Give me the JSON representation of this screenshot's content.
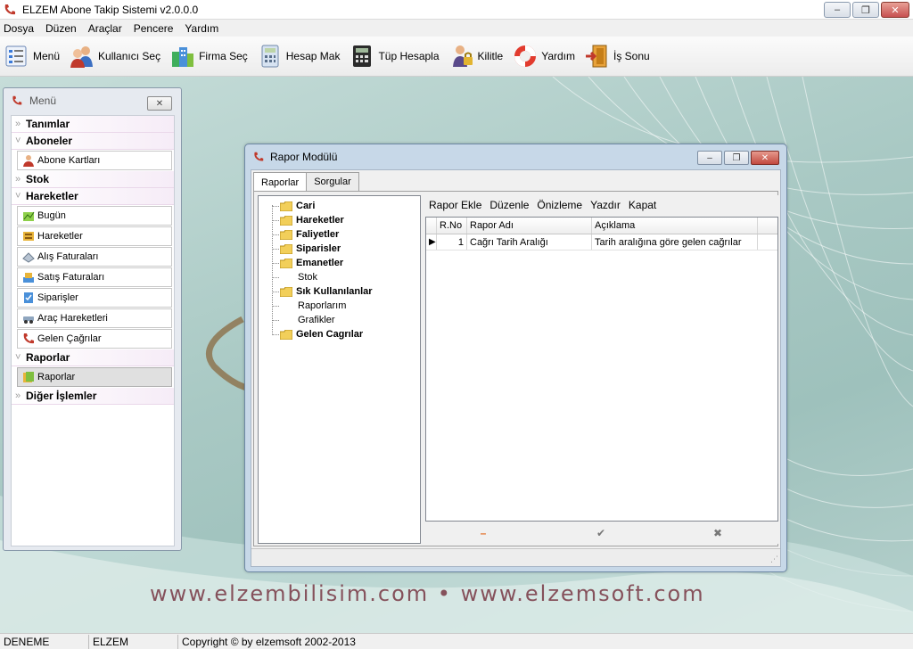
{
  "app": {
    "title": "ELZEM Abone Takip Sistemi v2.0.0.0",
    "window_controls": {
      "minimize": "–",
      "maximize": "❐",
      "close": "✕"
    }
  },
  "menubar": [
    "Dosya",
    "Düzen",
    "Araçlar",
    "Pencere",
    "Yardım"
  ],
  "toolbar": [
    {
      "label": "Menü",
      "icon": "menu-list-icon"
    },
    {
      "label": "Kullanıcı Seç",
      "icon": "users-icon"
    },
    {
      "label": "Firma Seç",
      "icon": "buildings-icon"
    },
    {
      "label": "Hesap Mak",
      "icon": "calculator-icon"
    },
    {
      "label": "Tüp Hesapla",
      "icon": "calculator-dark-icon"
    },
    {
      "label": "Kilitle",
      "icon": "lock-person-icon"
    },
    {
      "label": "Yardım",
      "icon": "lifebuoy-icon"
    },
    {
      "label": "İş Sonu",
      "icon": "exit-door-icon"
    }
  ],
  "menu_panel": {
    "title": "Menü",
    "close": "✕",
    "groups": [
      {
        "label": "Tanımlar",
        "expanded": false,
        "items": []
      },
      {
        "label": "Aboneler",
        "expanded": true,
        "items": [
          "Abone Kartları"
        ]
      },
      {
        "label": "Stok",
        "expanded": false,
        "items": []
      },
      {
        "label": "Hareketler",
        "expanded": true,
        "items": [
          "Bugün",
          "Hareketler",
          "Alış Faturaları",
          "Satış Faturaları",
          "Siparişler",
          "Araç Hareketleri",
          "Gelen Çağrılar"
        ]
      },
      {
        "label": "Raporlar",
        "expanded": true,
        "items": [
          "Raporlar"
        ]
      },
      {
        "label": "Diğer İşlemler",
        "expanded": false,
        "items": []
      }
    ]
  },
  "report_window": {
    "title": "Rapor Modülü",
    "tabs": [
      "Raporlar",
      "Sorgular"
    ],
    "active_tab": "Raporlar",
    "tree": [
      {
        "label": "Cari",
        "bold": true,
        "folder": true
      },
      {
        "label": "Hareketler",
        "bold": true,
        "folder": true
      },
      {
        "label": "Faliyetler",
        "bold": true,
        "folder": true
      },
      {
        "label": "Siparisler",
        "bold": true,
        "folder": true
      },
      {
        "label": "Emanetler",
        "bold": true,
        "folder": true
      },
      {
        "label": "Stok",
        "bold": false,
        "folder": false
      },
      {
        "label": "Sık Kullanılanlar",
        "bold": true,
        "folder": true
      },
      {
        "label": "Raporlarım",
        "bold": false,
        "folder": false
      },
      {
        "label": "Grafikler",
        "bold": false,
        "folder": false
      },
      {
        "label": "Gelen Cagrılar",
        "bold": true,
        "folder": true
      }
    ],
    "actions": [
      "Rapor Ekle",
      "Düzenle",
      "Önizleme",
      "Yazdır",
      "Kapat"
    ],
    "grid": {
      "columns": [
        "R.No",
        "Rapor Adı",
        "Açıklama"
      ],
      "rows": [
        [
          "1",
          "Cağrı Tarih Aralığı",
          "Tarih aralığına göre gelen cağrılar"
        ]
      ]
    },
    "footer_buttons": {
      "remove": "–",
      "confirm": "✔",
      "cancel": "✖"
    }
  },
  "watermark": "www.elzembilisim.com • www.elzemsoft.com",
  "statusbar": [
    "DENEME",
    "ELZEM",
    "Copyright © by elzemsoft 2002-2013"
  ]
}
